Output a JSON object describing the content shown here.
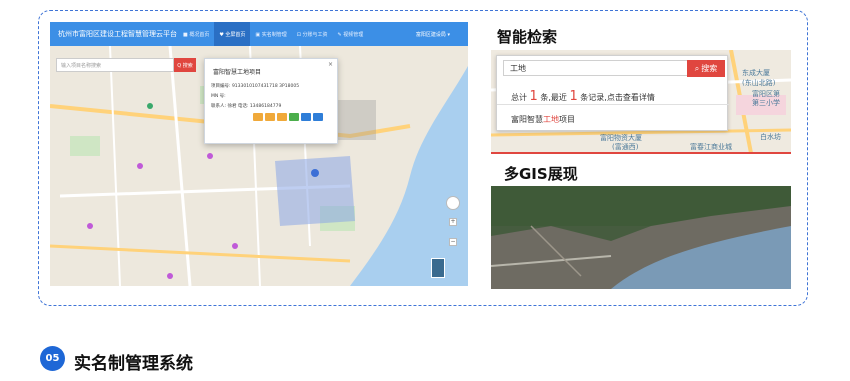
{
  "app": {
    "title": "杭州市富阳区建设工程智慧管理云平台",
    "nav": [
      {
        "label": "■ 概况首页",
        "active": false
      },
      {
        "label": "♥ 全屏首页",
        "active": true
      },
      {
        "label": "▣ 实名制管理",
        "active": false
      },
      {
        "label": "⊡ 分账与工资",
        "active": false
      },
      {
        "label": "✎ 视频管理",
        "active": false
      }
    ],
    "user": "富阳区建设局 ▾",
    "search_placeholder": "输入项目名称搜索",
    "search_button": "Q 搜索",
    "popup": {
      "title": "富阳智慧工地项目",
      "close": "×",
      "code_line": "项目编号: 9133010107431718 3P18005",
      "mn_line": "MN 号:",
      "contact_line": "联系人: 徐君    电话: 13486184779"
    }
  },
  "smart_search": {
    "heading": "智能检索",
    "input_value": "工地",
    "button_label": "搜索",
    "result_prefix": "总计",
    "result_count": "1",
    "result_mid": "条,最近",
    "result_recent": "1",
    "result_suffix": "条记录,点击查看详情",
    "item_prefix": "富阳智慧",
    "item_highlight": "工地",
    "item_suffix": "项目",
    "map_labels": [
      "东成大厦",
      "(东山北路)",
      "富阳区第",
      "第三小学",
      "富阳物资大厦",
      "(富通西)",
      "富春江商业城",
      "白水坊"
    ]
  },
  "gis": {
    "heading": "多GIS展现"
  },
  "section": {
    "number": "05",
    "title": "实名制管理系统"
  },
  "colors": {
    "accent_blue": "#3c8fe6",
    "brand_red": "#e0463f",
    "dash_border": "#3f74d6"
  }
}
